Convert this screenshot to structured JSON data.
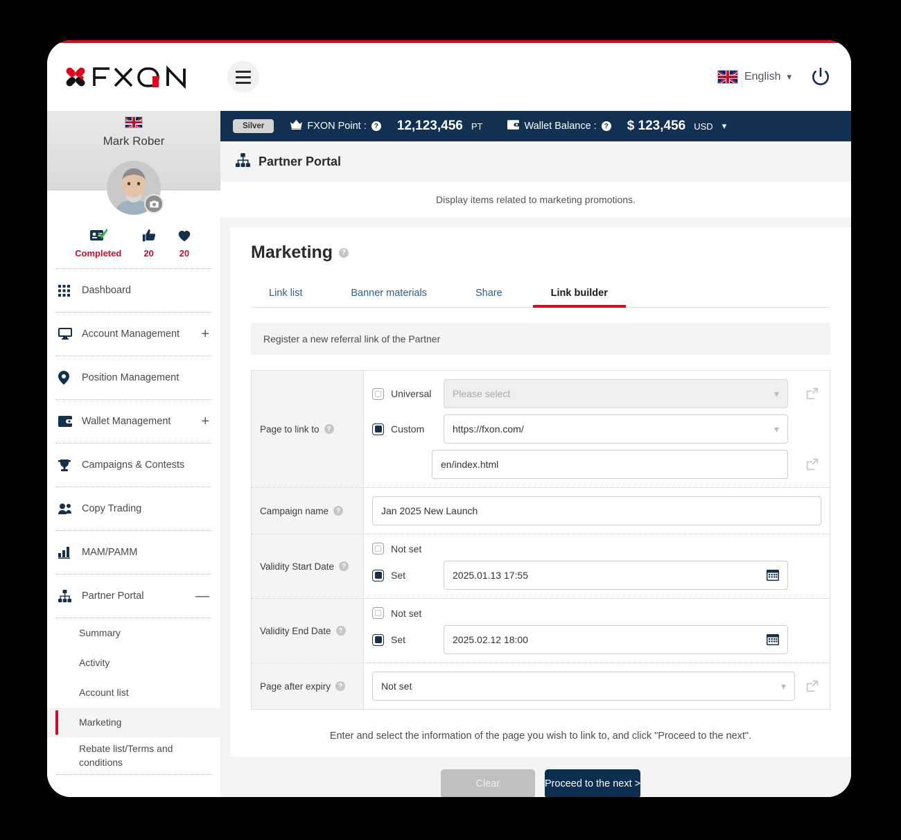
{
  "header": {
    "brand": "FXON",
    "menu_icon": "hamburger-icon",
    "language": "English",
    "power_icon": "power-icon"
  },
  "status_bar": {
    "tier_badge": "Silver",
    "point_label": "FXON Point :",
    "point_value": "12,123,456",
    "point_unit": "PT",
    "wallet_label": "Wallet Balance :",
    "wallet_value": "$ 123,456",
    "wallet_unit": "USD"
  },
  "sidebar": {
    "user_name": "Mark Rober",
    "stats": [
      {
        "icon": "id-verified-icon",
        "value": "Completed"
      },
      {
        "icon": "thumbs-up-icon",
        "value": "20"
      },
      {
        "icon": "heart-icon",
        "value": "20"
      }
    ],
    "items": [
      {
        "label": "Dashboard",
        "icon": "grid-icon",
        "expand": ""
      },
      {
        "label": "Account Management",
        "icon": "monitor-icon",
        "expand": "+"
      },
      {
        "label": "Position Management",
        "icon": "pin-icon",
        "expand": ""
      },
      {
        "label": "Wallet Management",
        "icon": "wallet-icon",
        "expand": "+"
      },
      {
        "label": "Campaigns & Contests",
        "icon": "trophy-icon",
        "expand": ""
      },
      {
        "label": "Copy Trading",
        "icon": "people-icon",
        "expand": ""
      },
      {
        "label": "MAM/PAMM",
        "icon": "bar-chart-icon",
        "expand": ""
      },
      {
        "label": "Partner Portal",
        "icon": "sitemap-icon",
        "expand": "—"
      }
    ],
    "sub_items": [
      {
        "label": "Summary",
        "active": false
      },
      {
        "label": "Activity",
        "active": false
      },
      {
        "label": "Account list",
        "active": false
      },
      {
        "label": "Marketing",
        "active": true
      },
      {
        "label": "Rebate list/Terms and conditions",
        "active": false
      }
    ]
  },
  "main": {
    "page_title": "Partner Portal",
    "page_icon": "sitemap-icon",
    "description": "Display items related to marketing promotions.",
    "section_title": "Marketing",
    "tabs": [
      {
        "label": "Link list",
        "active": false
      },
      {
        "label": "Banner materials",
        "active": false
      },
      {
        "label": "Share",
        "active": false
      },
      {
        "label": "Link builder",
        "active": true
      }
    ],
    "register_note": "Register a new referral link of the Partner",
    "form": {
      "page_to_link": {
        "label": "Page to link to",
        "universal_option": "Universal",
        "universal_selected": false,
        "universal_placeholder": "Please select",
        "custom_option": "Custom",
        "custom_selected": true,
        "custom_domain": "https://fxon.com/",
        "custom_path": "en/index.html"
      },
      "campaign_name": {
        "label": "Campaign name",
        "value": "Jan 2025 New Launch"
      },
      "validity_start": {
        "label": "Validity Start Date",
        "not_set_option": "Not set",
        "set_option": "Set",
        "value": "2025.01.13 17:55"
      },
      "validity_end": {
        "label": "Validity End Date",
        "not_set_option": "Not set",
        "set_option": "Set",
        "value": "2025.02.12 18:00"
      },
      "page_after_expiry": {
        "label": "Page after expiry",
        "value": "Not set"
      }
    },
    "hint": "Enter and select the information of the page you wish to link to, and click \"Proceed to the next\".",
    "clear_button": "Clear",
    "next_button": "Proceed to the next >"
  },
  "colors": {
    "navy": "#113052",
    "red": "#e3051b",
    "accent_red": "#cf0a2c"
  }
}
